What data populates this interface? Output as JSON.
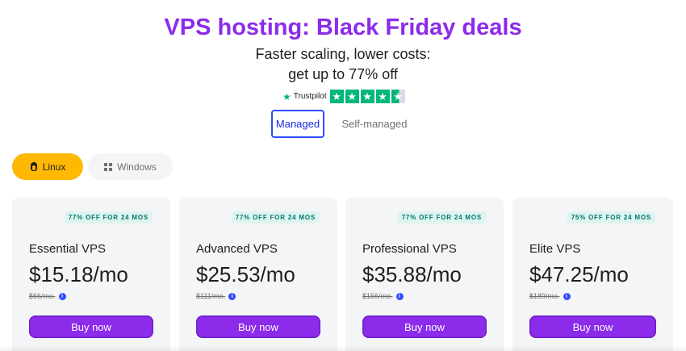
{
  "hero": {
    "title": "VPS hosting: Black Friday deals",
    "subtitle_line1": "Faster scaling, lower costs:",
    "subtitle_line2": "get up to 77% off"
  },
  "trustpilot": {
    "star_icon": "trustpilot-star-icon",
    "label": "Trustpilot",
    "rating_stars_full": 4,
    "rating_stars_partial": 0.5,
    "brand_color": "#00b67a"
  },
  "hosting_type_tabs": {
    "selected": "Managed",
    "items": [
      "Managed",
      "Self-managed"
    ]
  },
  "os_toggle": {
    "selected": "Linux",
    "items": [
      {
        "label": "Linux",
        "icon": "linux-icon"
      },
      {
        "label": "Windows",
        "icon": "windows-icon"
      }
    ]
  },
  "plans": [
    {
      "badge": "77% OFF FOR 24 MOS",
      "name": "Essential VPS",
      "price": "$15.18/mo",
      "old_price": "$66/mo.",
      "cta": "Buy now"
    },
    {
      "badge": "77% OFF FOR 24 MOS",
      "name": "Advanced VPS",
      "price": "$25.53/mo",
      "old_price": "$111/mo.",
      "cta": "Buy now"
    },
    {
      "badge": "77% OFF FOR 24 MOS",
      "name": "Professional VPS",
      "price": "$35.88/mo",
      "old_price": "$156/mo.",
      "cta": "Buy now"
    },
    {
      "badge": "75% OFF FOR 24 MOS",
      "name": "Elite VPS",
      "price": "$47.25/mo",
      "old_price": "$189/mo.",
      "cta": "Buy now"
    }
  ],
  "colors": {
    "accent_purple": "#8c2bea",
    "linux_yellow": "#ffb902",
    "badge_bg": "#def4f0",
    "badge_text": "#00786b",
    "tab_border_blue": "#2f4bff"
  }
}
